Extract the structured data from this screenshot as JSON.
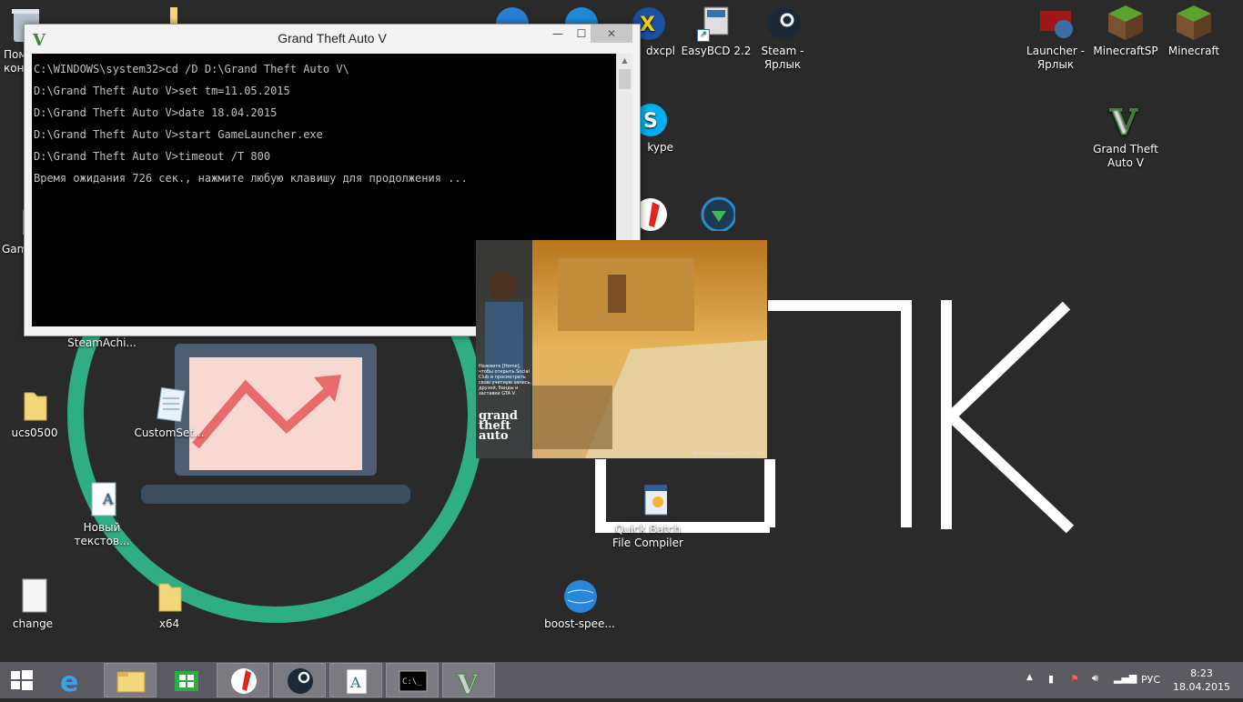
{
  "console": {
    "title": "Grand Theft Auto V",
    "lines": [
      "C:\\WINDOWS\\system32>cd /D D:\\Grand Theft Auto V\\",
      "D:\\Grand Theft Auto V>set tm=11.05.2015",
      "D:\\Grand Theft Auto V>date 18.04.2015",
      "D:\\Grand Theft Auto V>start GameLauncher.exe",
      "D:\\Grand Theft Auto V>timeout /T 800",
      "Время ожидания 726 сек., нажмите любую клавишу для продолжения ..."
    ],
    "minimize": "—",
    "maximize": "☐",
    "close": "✕"
  },
  "desktop": {
    "icons": [
      {
        "label": "Пом\nкон"
      },
      {
        "label": "Gam"
      },
      {
        "label": "SteamAchi..."
      },
      {
        "label": "ucs0500"
      },
      {
        "label": "CustomSet..."
      },
      {
        "label": "Новый\nтекстов..."
      },
      {
        "label": "change"
      },
      {
        "label": "x64"
      },
      {
        "label": "dxcpl"
      },
      {
        "label": "EasyBCD 2.2"
      },
      {
        "label": "Steam -\nЯрлык"
      },
      {
        "label": "kype"
      },
      {
        "label": "Quick Batch\nFile Compiler"
      },
      {
        "label": "boost-spee..."
      },
      {
        "label": "Launcher -\nЯрлык"
      },
      {
        "label": "MinecraftSP"
      },
      {
        "label": "Minecraft"
      },
      {
        "label": "Grand Theft\nAuto V"
      }
    ]
  },
  "wallpaper": {
    "big_text": "ДПК"
  },
  "splash": {
    "note": "Нажмите [Home], чтобы открыть Social Club и просмотреть свою учетную запись, друзей, банды и заставки GTA V.",
    "logo_line1": "grand",
    "logo_line2": "theft",
    "logo_line3": "auto",
    "footer": "Интегрированный Social Club"
  },
  "taskbar": {
    "items": [
      "start-icon",
      "internet-explorer-icon",
      "file-explorer-icon",
      "store-icon",
      "yandex-browser-icon",
      "steam-icon",
      "wordpad-icon",
      "cmd-icon",
      "gta-v-icon"
    ],
    "tray_lang": "РУС",
    "time": "8:23",
    "date": "18.04.2015"
  },
  "colors": {
    "accent_green": "#2fae86",
    "taskbar": "#5a5a60",
    "desktop": "#2b2a2a"
  }
}
